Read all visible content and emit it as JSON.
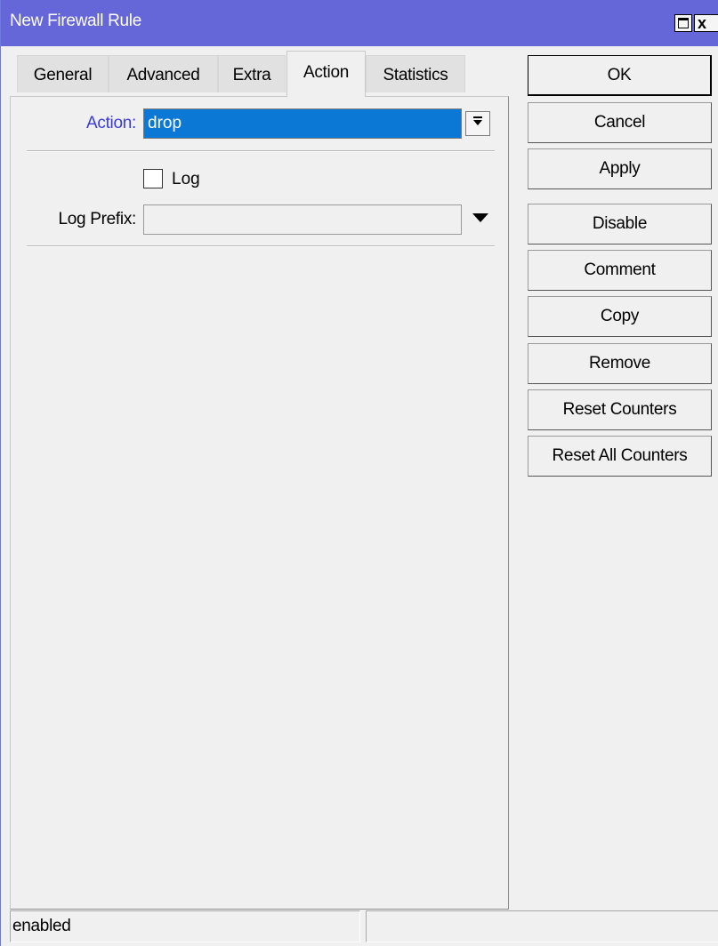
{
  "window": {
    "title": "New Firewall Rule",
    "close_glyph": "x"
  },
  "tabs": [
    {
      "label": "General"
    },
    {
      "label": "Advanced"
    },
    {
      "label": "Extra"
    },
    {
      "label": "Action",
      "active": true
    },
    {
      "label": "Statistics"
    }
  ],
  "form": {
    "action_label": "Action:",
    "action_value": "drop",
    "log_label": "Log",
    "log_checked": false,
    "log_prefix_label": "Log Prefix:",
    "log_prefix_value": ""
  },
  "buttons": {
    "ok": "OK",
    "cancel": "Cancel",
    "apply": "Apply",
    "disable": "Disable",
    "comment": "Comment",
    "copy": "Copy",
    "remove": "Remove",
    "reset_counters": "Reset Counters",
    "reset_all_counters": "Reset All Counters"
  },
  "status": {
    "left": "enabled",
    "right": ""
  },
  "colors": {
    "titlebar": "#6566d8",
    "selection": "#0c78d6",
    "action_label": "#3a3ad8"
  },
  "icons": {
    "maximize": "maximize-icon",
    "close": "close-icon",
    "dropdown": "dropdown-arrow-icon"
  }
}
